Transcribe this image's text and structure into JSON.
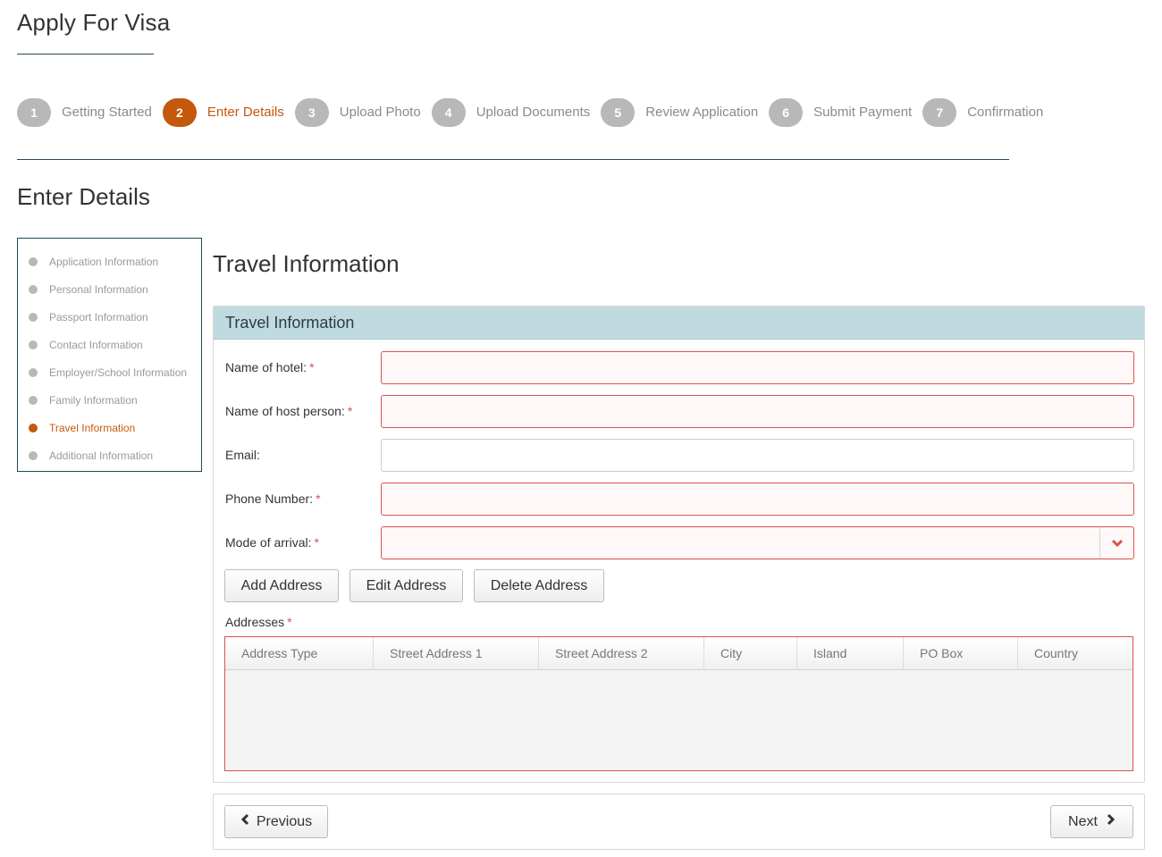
{
  "page": {
    "title": "Apply For Visa"
  },
  "steps": [
    {
      "num": "1",
      "label": "Getting Started"
    },
    {
      "num": "2",
      "label": "Enter Details"
    },
    {
      "num": "3",
      "label": "Upload Photo"
    },
    {
      "num": "4",
      "label": "Upload Documents"
    },
    {
      "num": "5",
      "label": "Review Application"
    },
    {
      "num": "6",
      "label": "Submit Payment"
    },
    {
      "num": "7",
      "label": "Confirmation"
    }
  ],
  "active_step": 2,
  "section": {
    "title": "Enter Details"
  },
  "sidebar": {
    "items": [
      {
        "label": "Application Information"
      },
      {
        "label": "Personal Information"
      },
      {
        "label": "Passport Information"
      },
      {
        "label": "Contact Information"
      },
      {
        "label": "Employer/School Information"
      },
      {
        "label": "Family Information"
      },
      {
        "label": "Travel Information"
      },
      {
        "label": "Additional Information"
      }
    ],
    "active_item": "Travel Information"
  },
  "main": {
    "heading": "Travel Information",
    "panel_title": "Travel Information",
    "fields": {
      "hotel": {
        "label": "Name of hotel:",
        "required": "*",
        "value": ""
      },
      "host": {
        "label": "Name of host person:",
        "required": "*",
        "value": ""
      },
      "email": {
        "label": "Email:",
        "value": ""
      },
      "phone": {
        "label": "Phone Number:",
        "required": "*",
        "value": ""
      },
      "arrival": {
        "label": "Mode of arrival:",
        "required": "*",
        "value": ""
      }
    },
    "buttons": {
      "add": "Add Address",
      "edit": "Edit Address",
      "delete": "Delete Address"
    },
    "addresses": {
      "label": "Addresses",
      "required": "*",
      "columns": [
        "Address Type",
        "Street Address 1",
        "Street Address 2",
        "City",
        "Island",
        "PO Box",
        "Country"
      ],
      "rows": []
    }
  },
  "footer": {
    "previous": "Previous",
    "next": "Next"
  },
  "colors": {
    "accent": "#c4580c",
    "step_inactive": "#b8b8b8",
    "panel_header": "#bfdbe0",
    "error": "#d9534f"
  }
}
